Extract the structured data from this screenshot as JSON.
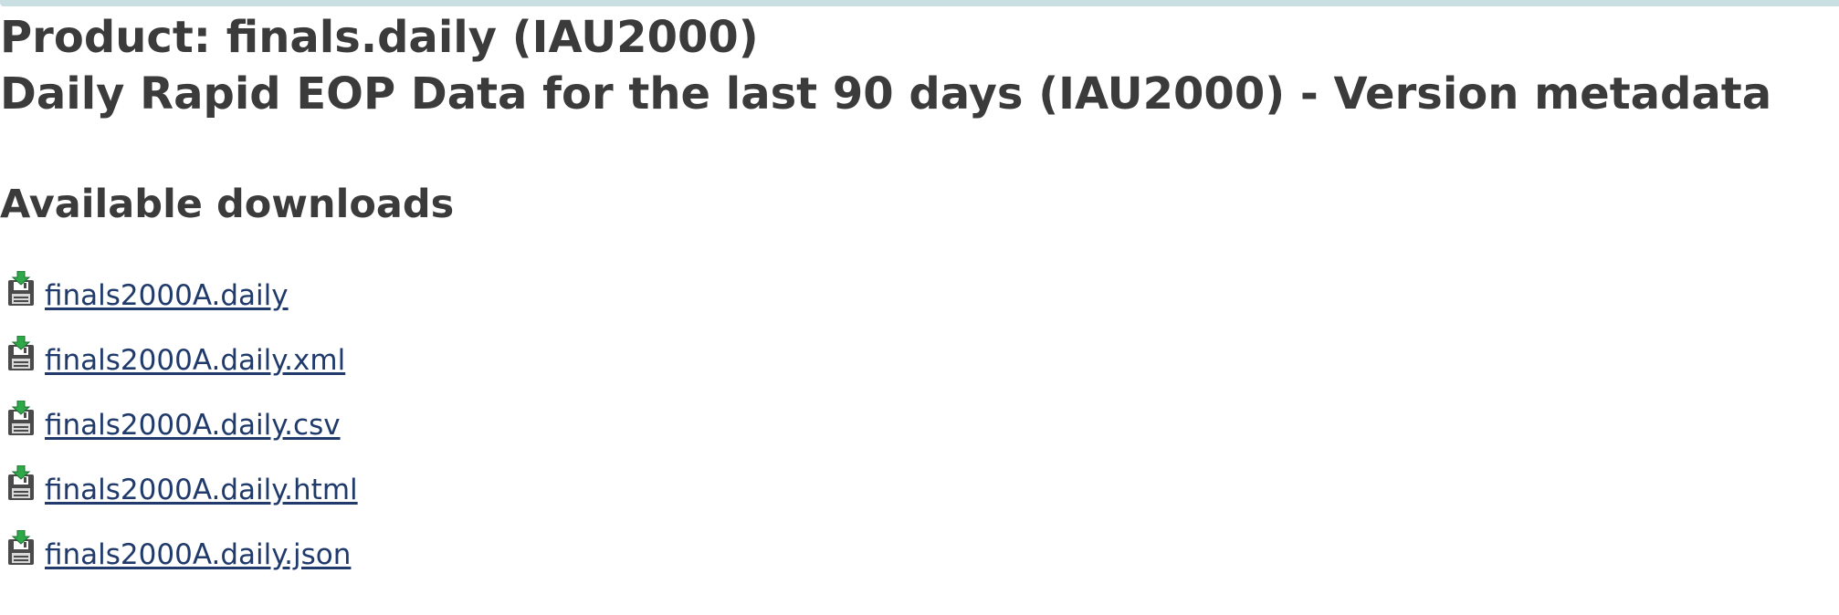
{
  "header": {
    "product_line": "Product: finals.daily (IAU2000)",
    "description_line": "Daily Rapid EOP Data for the last 90 days (IAU2000) - Version metadata"
  },
  "downloads": {
    "heading": "Available downloads",
    "items": [
      {
        "label": "finals2000A.daily",
        "icon": "floppy-download-icon"
      },
      {
        "label": "finals2000A.daily.xml",
        "icon": "floppy-download-icon"
      },
      {
        "label": "finals2000A.daily.csv",
        "icon": "floppy-download-icon"
      },
      {
        "label": "finals2000A.daily.html",
        "icon": "floppy-download-icon"
      },
      {
        "label": "finals2000A.daily.json",
        "icon": "floppy-download-icon"
      }
    ]
  },
  "colors": {
    "text": "#3b3b3b",
    "link": "#1f3a6b",
    "top_bar": "#c9dfe2",
    "icon_arrow": "#2fa84a"
  }
}
